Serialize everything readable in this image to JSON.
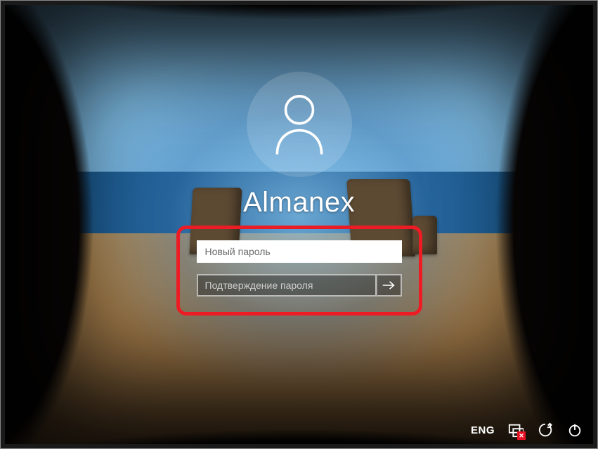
{
  "user": {
    "name": "Almanex"
  },
  "fields": {
    "new_password": {
      "placeholder": "Новый пароль"
    },
    "confirm_password": {
      "placeholder": "Подтверждение пароля"
    }
  },
  "tray": {
    "language": "ENG"
  },
  "icons": {
    "avatar": "user-icon",
    "submit": "arrow-right-icon",
    "network": "network-disconnected-icon",
    "ease": "ease-of-access-icon",
    "power": "power-icon"
  }
}
